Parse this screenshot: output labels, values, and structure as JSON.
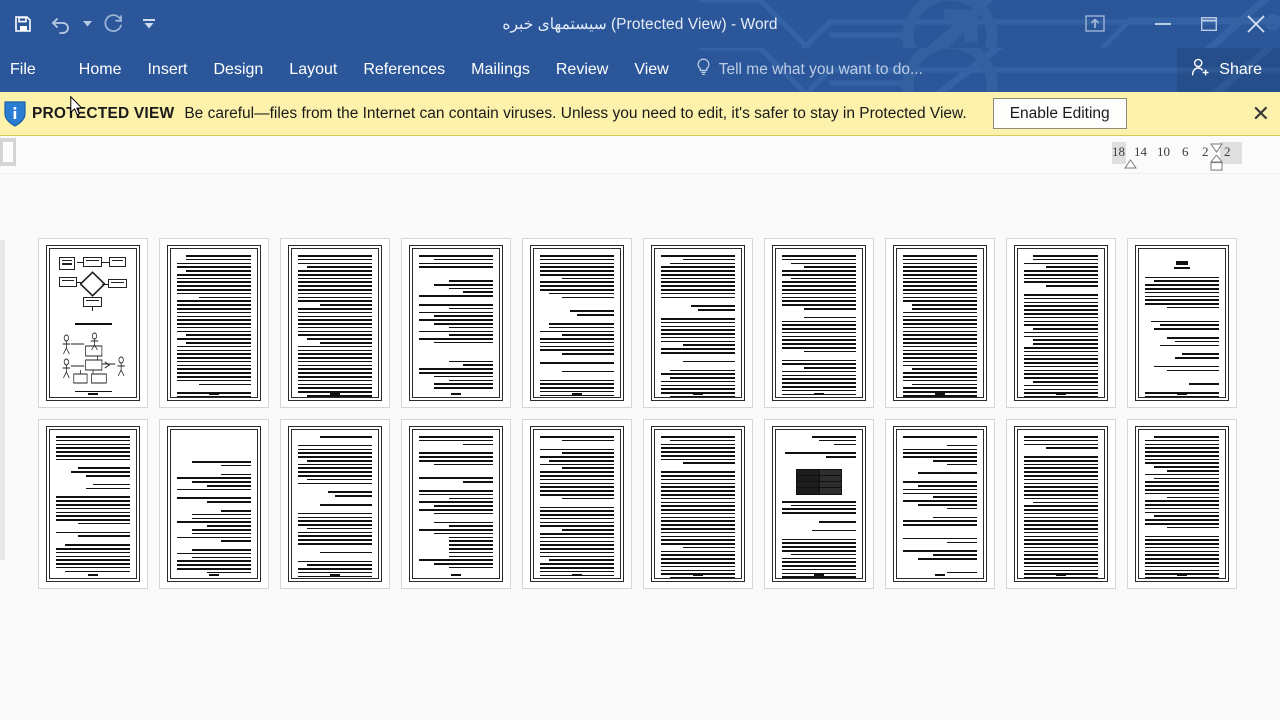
{
  "window": {
    "title": "سیستمهای خبره (Protected View) - Word",
    "app_name": "Word",
    "accent_color": "#2b579a"
  },
  "quick_access": {
    "save_label": "Save",
    "undo_label": "Undo",
    "undo_dropdown_label": "Undo dropdown",
    "redo_label": "Redo",
    "customize_label": "Customize Quick Access Toolbar"
  },
  "window_controls": {
    "ribbon_display_options_label": "Ribbon Display Options",
    "minimize_label": "Minimize",
    "restore_label": "Restore Down",
    "close_label": "Close",
    "close_glyph": "✕",
    "minimize_glyph": "—"
  },
  "ribbon": {
    "tabs": [
      {
        "label": "File"
      },
      {
        "label": "Home"
      },
      {
        "label": "Insert"
      },
      {
        "label": "Design"
      },
      {
        "label": "Layout"
      },
      {
        "label": "References"
      },
      {
        "label": "Mailings"
      },
      {
        "label": "Review"
      },
      {
        "label": "View"
      }
    ],
    "tell_me": {
      "placeholder": "Tell me what you want to do...",
      "icon": "lightbulb-icon"
    },
    "share": {
      "label": "Share",
      "icon": "person-add-icon"
    }
  },
  "protected_view": {
    "icon": "shield-info-icon",
    "title": "PROTECTED VIEW",
    "message": "Be careful—files from the Internet can contain viruses. Unless you need to edit, it's safer to stay in Protected View.",
    "enable_button": "Enable Editing",
    "close_glyph": "✕",
    "bar_color": "#fdf2ab"
  },
  "ruler": {
    "ticks": [
      "18",
      "14",
      "10",
      "6",
      "2",
      "2"
    ],
    "left_tab_selector": "tab-stop-selector"
  },
  "document": {
    "view_mode": "multiple-pages",
    "page_count": 20,
    "pages": [
      {
        "number": 1,
        "kind": "diagram"
      },
      {
        "number": 2,
        "kind": "dense-text"
      },
      {
        "number": 3,
        "kind": "dense-text"
      },
      {
        "number": 4,
        "kind": "sparse-text"
      },
      {
        "number": 5,
        "kind": "heading-text"
      },
      {
        "number": 6,
        "kind": "heading-text"
      },
      {
        "number": 7,
        "kind": "dense-text"
      },
      {
        "number": 8,
        "kind": "dense-text"
      },
      {
        "number": 9,
        "kind": "dense-text"
      },
      {
        "number": 10,
        "kind": "title-page"
      },
      {
        "number": 11,
        "kind": "list-text"
      },
      {
        "number": 12,
        "kind": "sparse-text"
      },
      {
        "number": 13,
        "kind": "heading-text"
      },
      {
        "number": 14,
        "kind": "sparse-text"
      },
      {
        "number": 15,
        "kind": "dense-text"
      },
      {
        "number": 16,
        "kind": "dense-text"
      },
      {
        "number": 17,
        "kind": "table-page"
      },
      {
        "number": 18,
        "kind": "sparse-text"
      },
      {
        "number": 19,
        "kind": "dense-text"
      },
      {
        "number": 20,
        "kind": "dense-text"
      }
    ]
  }
}
